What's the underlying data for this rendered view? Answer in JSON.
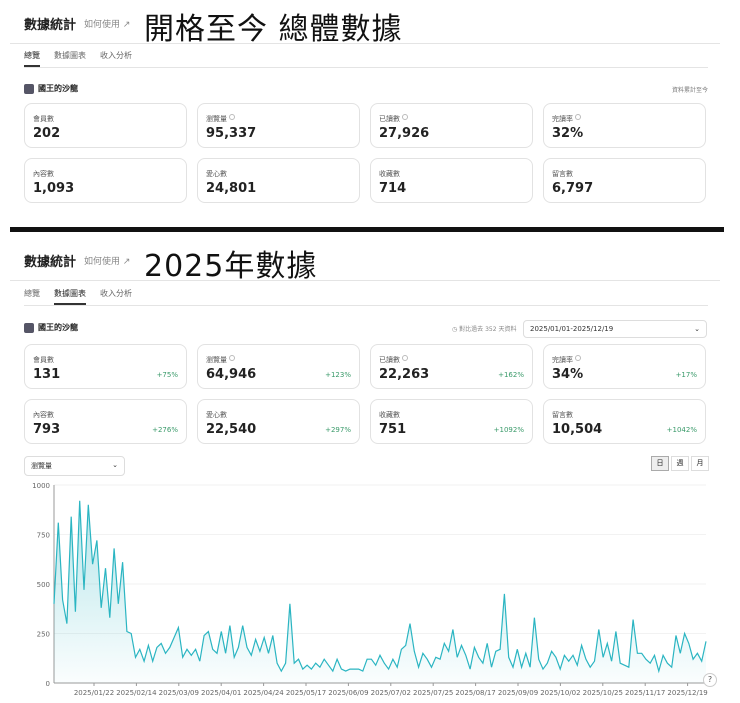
{
  "overall": {
    "title": "數據統計",
    "help": "如何使用",
    "caption": "開格至今 總體數據",
    "tabs": [
      "總覽",
      "數據圖表",
      "收入分析"
    ],
    "channel": "國王的沙龍",
    "note": "資料累計至今",
    "stats": [
      {
        "label": "會員數",
        "value": "202"
      },
      {
        "label": "瀏覽量",
        "value": "95,337"
      },
      {
        "label": "已讀數",
        "value": "27,926"
      },
      {
        "label": "完讀率",
        "value": "32%"
      },
      {
        "label": "內容數",
        "value": "1,093"
      },
      {
        "label": "愛心數",
        "value": "24,801"
      },
      {
        "label": "收藏數",
        "value": "714"
      },
      {
        "label": "留言數",
        "value": "6,797"
      }
    ]
  },
  "year": {
    "title": "數據統計",
    "help": "如何使用",
    "caption": "2025年數據",
    "tabs": [
      "總覽",
      "數據圖表",
      "收入分析"
    ],
    "channel": "國王的沙龍",
    "compare": "對比過去 352 天資料",
    "range": "2025/01/01-2025/12/19",
    "stats": [
      {
        "label": "會員數",
        "value": "131",
        "change": "+75%"
      },
      {
        "label": "瀏覽量",
        "value": "64,946",
        "change": "+123%"
      },
      {
        "label": "已讀數",
        "value": "22,263",
        "change": "+162%"
      },
      {
        "label": "完讀率",
        "value": "34%",
        "change": "+17%"
      },
      {
        "label": "內容數",
        "value": "793",
        "change": "+276%"
      },
      {
        "label": "愛心數",
        "value": "22,540",
        "change": "+297%"
      },
      {
        "label": "收藏數",
        "value": "751",
        "change": "+1092%"
      },
      {
        "label": "留言數",
        "value": "10,504",
        "change": "+1042%"
      }
    ],
    "metric_select": "瀏覽量",
    "granularity": [
      "日",
      "週",
      "月"
    ],
    "active_granularity": "日"
  },
  "chart_data": {
    "type": "area",
    "x_start": "2025/01/01",
    "x_end": "2025/12/19",
    "days": 352,
    "ylim": [
      0,
      1000
    ],
    "yticks": [
      0,
      250,
      500,
      750,
      1000
    ],
    "xticks": [
      "2025/01/22",
      "2025/02/14",
      "2025/03/09",
      "2025/04/01",
      "2025/04/24",
      "2025/05/17",
      "2025/06/09",
      "2025/07/02",
      "2025/07/25",
      "2025/08/17",
      "2025/09/09",
      "2025/10/02",
      "2025/10/25",
      "2025/11/17",
      "2025/12/19"
    ],
    "color": "#2bb5c2",
    "values": [
      400,
      810,
      420,
      300,
      840,
      360,
      920,
      470,
      900,
      600,
      720,
      380,
      580,
      330,
      680,
      400,
      610,
      260,
      250,
      130,
      170,
      110,
      190,
      110,
      180,
      200,
      150,
      180,
      230,
      280,
      130,
      170,
      140,
      170,
      110,
      240,
      260,
      170,
      150,
      260,
      150,
      290,
      130,
      180,
      290,
      180,
      140,
      220,
      160,
      230,
      150,
      240,
      100,
      60,
      100,
      400,
      100,
      120,
      70,
      90,
      70,
      100,
      80,
      120,
      90,
      60,
      120,
      70,
      60,
      70,
      70,
      70,
      60,
      120,
      120,
      90,
      140,
      100,
      70,
      120,
      80,
      170,
      190,
      300,
      160,
      80,
      150,
      120,
      80,
      130,
      120,
      200,
      160,
      270,
      130,
      190,
      140,
      70,
      180,
      130,
      100,
      200,
      80,
      160,
      170,
      450,
      130,
      80,
      170,
      80,
      150,
      80,
      330,
      120,
      70,
      100,
      160,
      130,
      70,
      140,
      110,
      140,
      90,
      190,
      120,
      80,
      110,
      270,
      130,
      200,
      110,
      260,
      100,
      90,
      80,
      320,
      150,
      150,
      120,
      100,
      140,
      60,
      140,
      100,
      80,
      240,
      150,
      250,
      200,
      120,
      150,
      110,
      210
    ]
  }
}
